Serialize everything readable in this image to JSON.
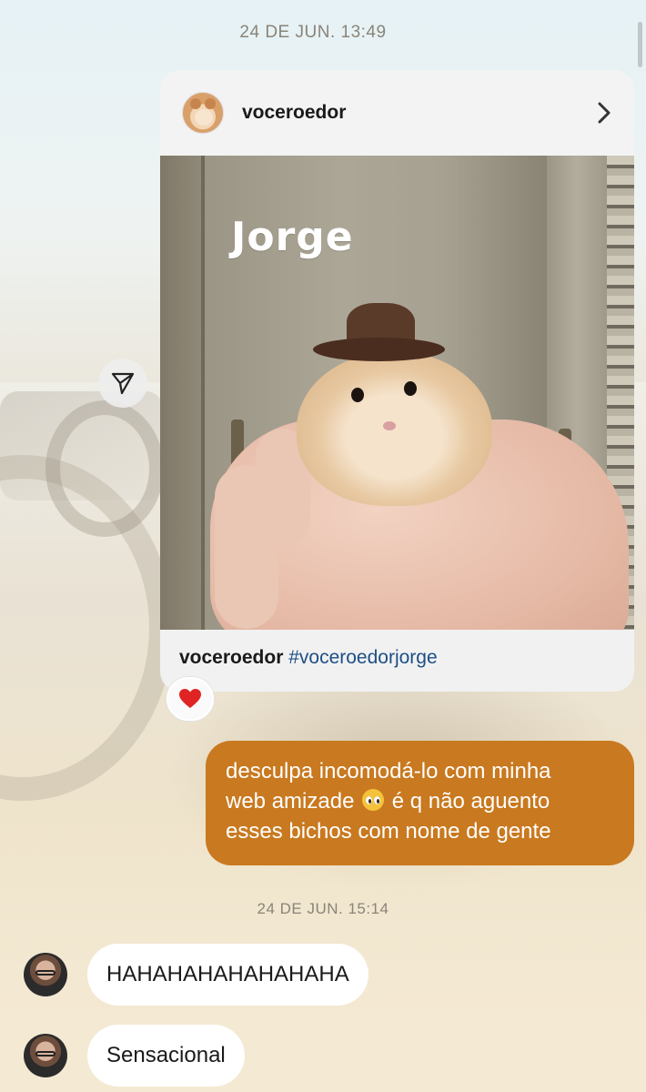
{
  "timestamps": {
    "first": "24 DE JUN. 13:49",
    "second": "24 DE JUN. 15:14"
  },
  "shared_post": {
    "username": "voceroedor",
    "avatar_icon": "hamster-avatar",
    "open_icon": "chevron-right-icon",
    "image_title": "Jorge",
    "caption_user": "voceroedor",
    "caption_hashtag": "#voceroedorjorge"
  },
  "share_button": {
    "icon": "paper-plane-icon"
  },
  "reaction": {
    "emoji": "❤️",
    "icon": "heart-icon",
    "color": "#e02424"
  },
  "outgoing_message": {
    "line1": "desculpa incomodá-lo com minha",
    "line2_before": "web amizade",
    "line2_emoji": "pleading-face",
    "line2_after": "é q não aguento",
    "line3": "esses bichos com nome de gente",
    "bubble_color": "#c9791f"
  },
  "incoming_messages": [
    {
      "text": "HAHAHAHAHAHAHAHA"
    },
    {
      "text": "Sensacional"
    }
  ]
}
